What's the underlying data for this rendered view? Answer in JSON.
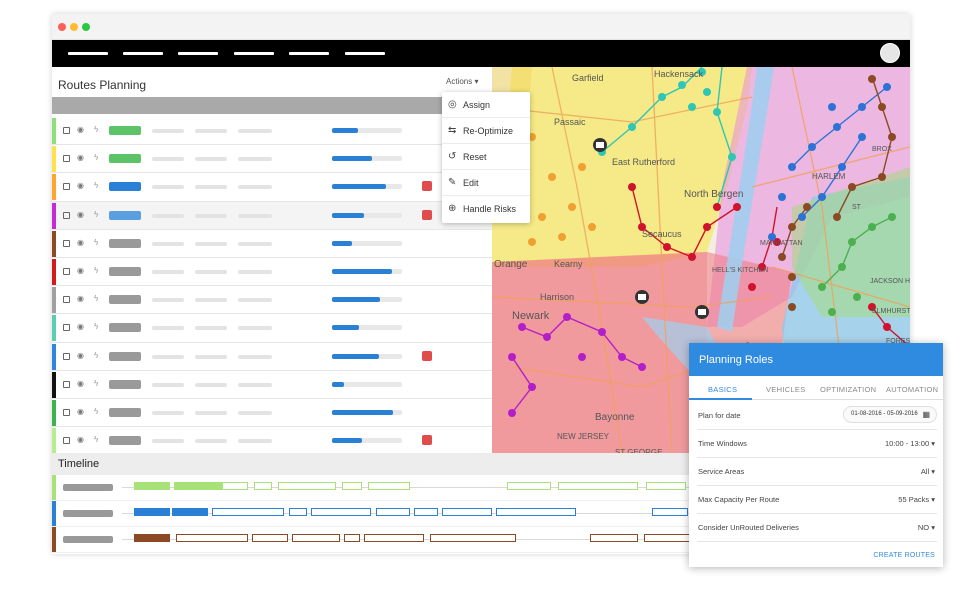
{
  "panel": {
    "title": "Routes Planning",
    "actions_label": "Actions ▾"
  },
  "menu": {
    "items": [
      {
        "label": "Assign",
        "icon": "play-circle-icon",
        "glyph": "◎"
      },
      {
        "label": "Re-Optimize",
        "icon": "swap-icon",
        "glyph": "⇆"
      },
      {
        "label": "Reset",
        "icon": "undo-icon",
        "glyph": "↺"
      },
      {
        "label": "Edit",
        "icon": "pencil-icon",
        "glyph": "✎"
      },
      {
        "label": "Handle Risks",
        "icon": "target-icon",
        "glyph": "⊕"
      }
    ]
  },
  "routes": [
    {
      "color": "#8be07a",
      "pill": "#5cc466",
      "progress": 0.37,
      "risk": false
    },
    {
      "color": "#ffe14a",
      "pill": "#5cc466",
      "progress": 0.57,
      "risk": false
    },
    {
      "color": "#ffa52e",
      "pill": "#2a80d4",
      "progress": 0.77,
      "risk": true
    },
    {
      "color": "#c22bd6",
      "pill": "#5a9fe0",
      "progress": 0.46,
      "risk": true
    },
    {
      "color": "#8b4a24",
      "pill": "#9a9a9a",
      "progress": 0.29,
      "risk": false
    },
    {
      "color": "#d01c1c",
      "pill": "#9a9a9a",
      "progress": 0.85,
      "risk": false
    },
    {
      "color": "#a0a0a0",
      "pill": "#9a9a9a",
      "progress": 0.68,
      "risk": false
    },
    {
      "color": "#59cfb1",
      "pill": "#9a9a9a",
      "progress": 0.39,
      "risk": false
    },
    {
      "color": "#2e86e0",
      "pill": "#9a9a9a",
      "progress": 0.67,
      "risk": true
    },
    {
      "color": "#111111",
      "pill": "#9a9a9a",
      "progress": 0.17,
      "risk": false
    },
    {
      "color": "#3db24e",
      "pill": "#9a9a9a",
      "progress": 0.87,
      "risk": false
    },
    {
      "color": "#b4ee8e",
      "pill": "#9a9a9a",
      "progress": 0.43,
      "risk": true
    }
  ],
  "timeline": {
    "title": "Timeline",
    "rows": [
      {
        "color": "#a6e278"
      },
      {
        "color": "#2a80d4"
      },
      {
        "color": "#8b4a24"
      }
    ]
  },
  "map": {
    "labels": [
      "Garfield",
      "Hackensack",
      "Passaic",
      "East Rutherford",
      "North Bergen",
      "Secaucus",
      "Kearny",
      "Orange",
      "Harrison",
      "Newark",
      "New York",
      "MANHATTAN",
      "HARLEM",
      "Bayonne",
      "NEW JERSEY",
      "ST GEORGE",
      "JACKSON HEIGHTS",
      "ELMHURST",
      "FOREST",
      "BROX",
      "HELL'S KITCHEN",
      "ST"
    ]
  },
  "planning_roles": {
    "title": "Planning Roles",
    "tabs": [
      "BASICS",
      "VEHICLES",
      "OPTIMIZATION",
      "AUTOMATION"
    ],
    "fields": [
      {
        "label": "Plan for date",
        "value": "01-08-2016 - 05-09-2016"
      },
      {
        "label": "Time Windows",
        "value": "10:00 - 13:00 ▾"
      },
      {
        "label": "Service Areas",
        "value": "All ▾"
      },
      {
        "label": "Max Capacity Per Route",
        "value": "55 Packs ▾"
      },
      {
        "label": "Consider UnRouted Deliveries",
        "value": "NO ▾"
      }
    ],
    "create_label": "CREATE ROUTES"
  }
}
